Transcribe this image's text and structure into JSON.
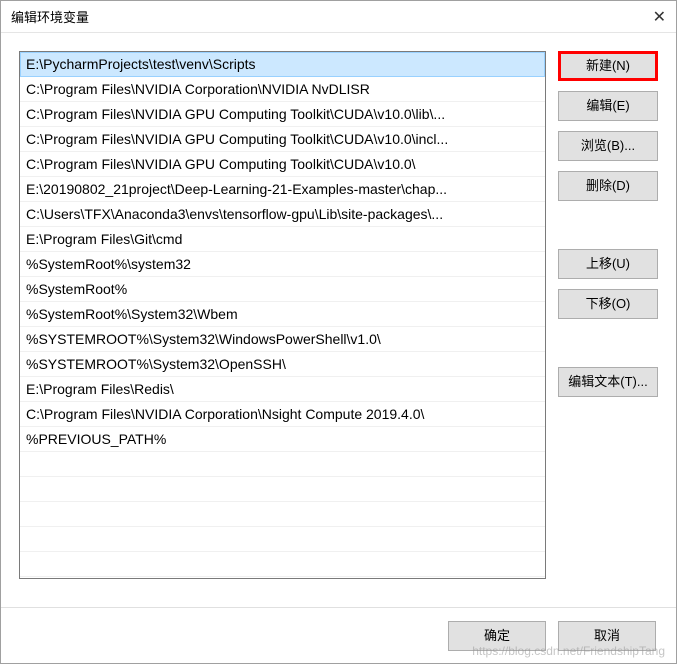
{
  "window": {
    "title": "编辑环境变量"
  },
  "paths": [
    "E:\\PycharmProjects\\test\\venv\\Scripts",
    "C:\\Program Files\\NVIDIA Corporation\\NVIDIA NvDLISR",
    "C:\\Program Files\\NVIDIA GPU Computing Toolkit\\CUDA\\v10.0\\lib\\...",
    "C:\\Program Files\\NVIDIA GPU Computing Toolkit\\CUDA\\v10.0\\incl...",
    "C:\\Program Files\\NVIDIA GPU Computing Toolkit\\CUDA\\v10.0\\",
    "E:\\20190802_21project\\Deep-Learning-21-Examples-master\\chap...",
    "C:\\Users\\TFX\\Anaconda3\\envs\\tensorflow-gpu\\Lib\\site-packages\\...",
    "E:\\Program Files\\Git\\cmd",
    "%SystemRoot%\\system32",
    "%SystemRoot%",
    "%SystemRoot%\\System32\\Wbem",
    "%SYSTEMROOT%\\System32\\WindowsPowerShell\\v1.0\\",
    "%SYSTEMROOT%\\System32\\OpenSSH\\",
    "E:\\Program Files\\Redis\\",
    "C:\\Program Files\\NVIDIA Corporation\\Nsight Compute 2019.4.0\\",
    "%PREVIOUS_PATH%"
  ],
  "selected_index": 0,
  "buttons": {
    "new": "新建(N)",
    "edit": "编辑(E)",
    "browse": "浏览(B)...",
    "delete": "删除(D)",
    "moveup": "上移(U)",
    "movedown": "下移(O)",
    "edittext": "编辑文本(T)...",
    "ok": "确定",
    "cancel": "取消"
  },
  "watermark": "https://blog.csdn.net/FriendshipTang"
}
